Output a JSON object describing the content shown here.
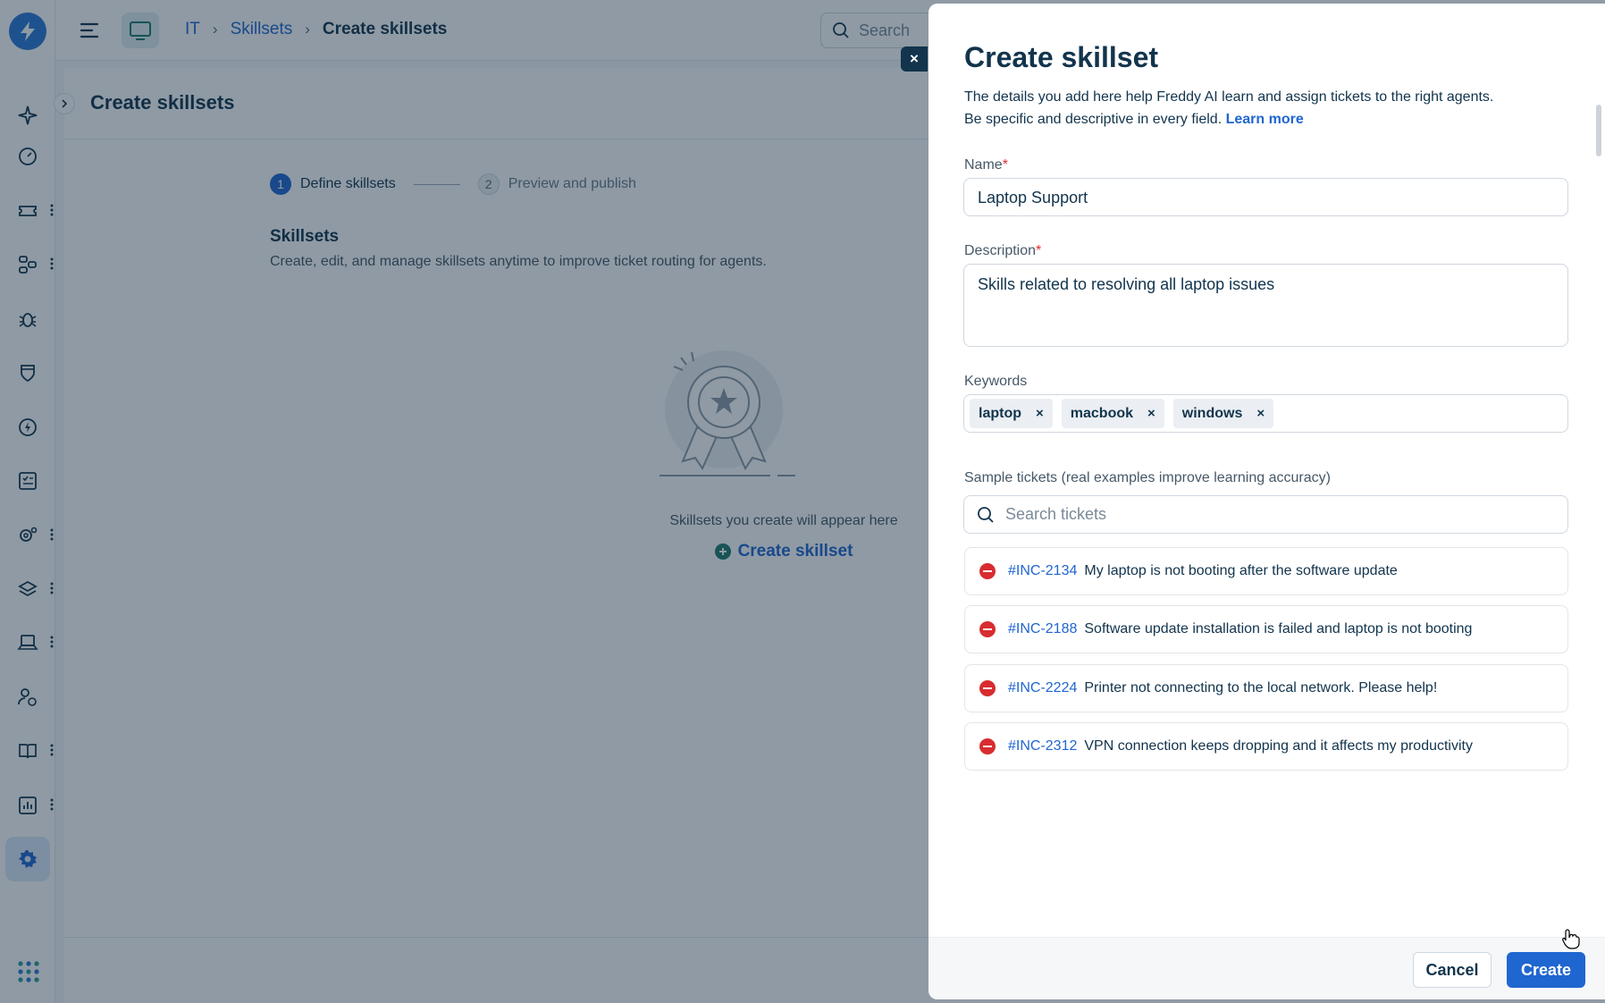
{
  "topbar": {
    "breadcrumbs": [
      "IT",
      "Skillsets",
      "Create skillsets"
    ],
    "search_placeholder": "Search"
  },
  "page": {
    "title": "Create skillsets",
    "steps": [
      {
        "num": "1",
        "label": "Define skillsets"
      },
      {
        "num": "2",
        "label": "Preview and publish"
      }
    ],
    "section_title": "Skillsets",
    "section_subtitle": "Create, edit, and manage skillsets anytime to improve ticket routing for agents.",
    "empty_message": "Skillsets you create will appear here",
    "empty_cta": "Create skillset"
  },
  "drawer": {
    "close_label": "×",
    "title": "Create skillset",
    "description_line1": "The details you add here help Freddy AI learn and assign tickets to the right agents.",
    "description_line2": "Be specific and descriptive in every field.",
    "learn_more": "Learn more",
    "name_label": "Name",
    "name_value": "Laptop Support",
    "description_label": "Description",
    "description_value": "Skills related to resolving all laptop issues",
    "required_mark": "*",
    "keywords_label": "Keywords",
    "keywords": [
      "laptop",
      "macbook",
      "windows"
    ],
    "tag_remove": "×",
    "sample_label": "Sample tickets (real examples improve learning accuracy)",
    "search_tickets_placeholder": "Search tickets",
    "tickets": [
      {
        "id": "#INC-2134",
        "subject": "My laptop is not booting after the software update"
      },
      {
        "id": "#INC-2188",
        "subject": "Software update installation is failed and laptop is not booting"
      },
      {
        "id": "#INC-2224",
        "subject": "Printer not connecting to the local network. Please help!"
      },
      {
        "id": "#INC-2312",
        "subject": "VPN connection keeps dropping and it affects my productivity"
      }
    ],
    "cancel_label": "Cancel",
    "create_label": "Create"
  },
  "colors": {
    "primary": "#2066d0",
    "text": "#12344d",
    "danger": "#d72d30",
    "overlay": "#12283e"
  }
}
